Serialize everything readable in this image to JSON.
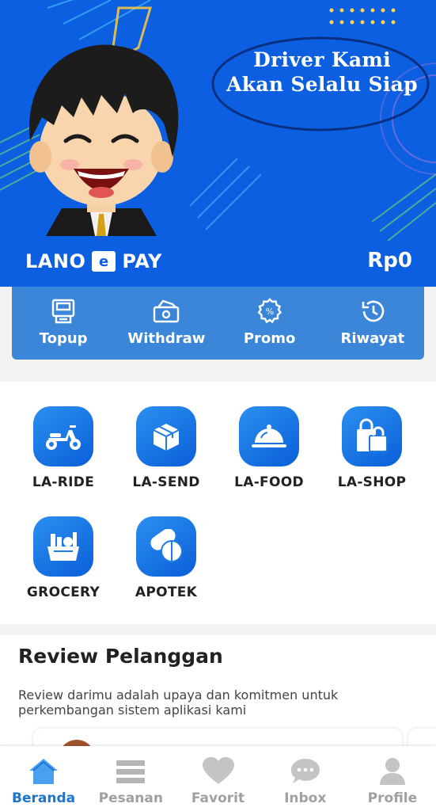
{
  "hero": {
    "tagline_line1": "Driver Kami",
    "tagline_line2": "Akan Selalu Siap",
    "brand_left": "LANO",
    "brand_logo_letter": "e",
    "brand_right": "PAY",
    "balance": "Rp0",
    "colors": {
      "background": "#0b5fe0",
      "accent": "#ffd54f"
    }
  },
  "wallet_actions": [
    {
      "label": "Topup",
      "icon": "topup-icon"
    },
    {
      "label": "Withdraw",
      "icon": "withdraw-icon"
    },
    {
      "label": "Promo",
      "icon": "promo-icon"
    },
    {
      "label": "Riwayat",
      "icon": "history-icon"
    }
  ],
  "services": [
    {
      "label": "LA-RIDE",
      "icon": "scooter-icon"
    },
    {
      "label": "LA-SEND",
      "icon": "package-icon"
    },
    {
      "label": "LA-FOOD",
      "icon": "food-cloche-icon"
    },
    {
      "label": "LA-SHOP",
      "icon": "shopping-bag-icon"
    },
    {
      "label": "GROCERY",
      "icon": "grocery-basket-icon"
    },
    {
      "label": "APOTEK",
      "icon": "pills-icon"
    }
  ],
  "review": {
    "title": "Review Pelanggan",
    "subtitle": "Review darimu adalah upaya dan komitmen untuk perkembangan sistem aplikasi kami"
  },
  "nav": [
    {
      "label": "Beranda",
      "icon": "home-icon",
      "active": true
    },
    {
      "label": "Pesanan",
      "icon": "list-icon",
      "active": false
    },
    {
      "label": "Favorit",
      "icon": "heart-icon",
      "active": false
    },
    {
      "label": "Inbox",
      "icon": "chat-icon",
      "active": false
    },
    {
      "label": "Profile",
      "icon": "person-icon",
      "active": false
    }
  ]
}
